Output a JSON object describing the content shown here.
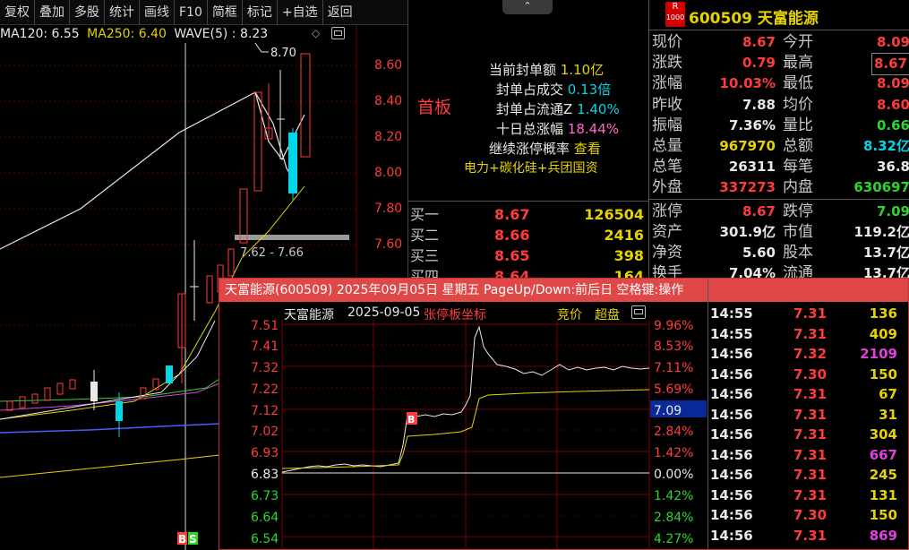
{
  "toolbar": [
    "复权",
    "叠加",
    "多股",
    "统计",
    "画线",
    "F10",
    "简框",
    "标记",
    "+自选",
    "返回"
  ],
  "kline": {
    "ma_legend": {
      "ma120": "MA120: 6.55",
      "ma250": "MA250: 6.40",
      "wave": "WAVE(5) : 8.23"
    },
    "yticks": [
      "8.60",
      "8.40",
      "8.20",
      "8.00",
      "7.80",
      "7.60"
    ],
    "high_label": "8.70",
    "range_label": "7.62 - 7.66",
    "markers": [
      "B",
      "S"
    ]
  },
  "info": {
    "first_board": "首板",
    "rows": [
      {
        "label": "当前封单额",
        "value": "1.10亿"
      },
      {
        "label": "封单占成交",
        "value": "0.13倍"
      },
      {
        "label": "封单占流通Z",
        "value": "1.40%"
      },
      {
        "label": "十日总涨幅",
        "value": "18.44%"
      },
      {
        "label": "继续涨停概率",
        "value": "查看"
      }
    ],
    "concepts": "电力+碳化硅+兵团国资"
  },
  "order_book": [
    {
      "label": "买一",
      "price": "8.67",
      "vol": "126504"
    },
    {
      "label": "买二",
      "price": "8.66",
      "vol": "2416"
    },
    {
      "label": "买三",
      "price": "8.65",
      "vol": "398"
    },
    {
      "label": "买四",
      "price": "8.64",
      "vol": "164"
    }
  ],
  "quote": {
    "badge_r": "R",
    "badge_num": "1000",
    "title": "600509 天富能源",
    "rows": [
      {
        "l1": "现价",
        "v1": "8.67",
        "l2": "今开",
        "v2": "8.09"
      },
      {
        "l1": "涨跌",
        "v1": "0.79",
        "l2": "最高",
        "v2": "8.67"
      },
      {
        "l1": "涨幅",
        "v1": "10.03%",
        "l2": "最低",
        "v2": "8.09"
      },
      {
        "l1": "昨收",
        "v1": "7.88",
        "l2": "均价",
        "v2": "8.60"
      },
      {
        "l1": "振幅",
        "v1": "7.36%",
        "l2": "量比",
        "v2": "0.66"
      },
      {
        "l1": "总量",
        "v1": "967970",
        "l2": "总额",
        "v2": "8.32亿"
      },
      {
        "l1": "总笔",
        "v1": "26311",
        "l2": "每笔",
        "v2": "36.8"
      },
      {
        "l1": "外盘",
        "v1": "337273",
        "l2": "内盘",
        "v2": "630697"
      },
      {
        "l1": "涨停",
        "v1": "8.67",
        "l2": "跌停",
        "v2": "7.09"
      },
      {
        "l1": "资产",
        "v1": "301.9亿",
        "l2": "市值",
        "v2": "119.2亿"
      },
      {
        "l1": "净资",
        "v1": "5.60",
        "l2": "股本",
        "v2": "13.7亿"
      },
      {
        "l1": "换手",
        "v1": "7.04%",
        "l2": "流通",
        "v2": "13.7亿"
      }
    ]
  },
  "popup": {
    "title": "天富能源(600509) 2025年09月05日 星期五 PageUp/Down:前后日 空格键:操作",
    "stock": "天富能源",
    "date": "2025-09-05",
    "limit_label": "张停板坐标",
    "btn_auction": "竞价",
    "btn_super": "超盘",
    "left_ticks": [
      "7.51",
      "7.41",
      "7.32",
      "7.22",
      "7.12",
      "7.02",
      "6.93",
      "6.83",
      "6.73",
      "6.64",
      "6.54"
    ],
    "right_ticks": [
      "9.96%",
      "8.53%",
      "7.11%",
      "5.69%",
      "4.27%",
      "2.84%",
      "1.42%",
      "0.00%",
      "1.42%",
      "2.84%",
      "4.27%"
    ],
    "current_box": "7.09",
    "buy_marker": "B"
  },
  "ticks": [
    {
      "time": "14:55",
      "price": "7.31",
      "vol": "136"
    },
    {
      "time": "14:55",
      "price": "7.31",
      "vol": "409"
    },
    {
      "time": "14:56",
      "price": "7.32",
      "vol": "2109"
    },
    {
      "time": "14:56",
      "price": "7.30",
      "vol": "150"
    },
    {
      "time": "14:56",
      "price": "7.31",
      "vol": "67"
    },
    {
      "time": "14:56",
      "price": "7.31",
      "vol": "31"
    },
    {
      "time": "14:56",
      "price": "7.31",
      "vol": "304"
    },
    {
      "time": "14:56",
      "price": "7.31",
      "vol": "667"
    },
    {
      "time": "14:56",
      "price": "7.31",
      "vol": "245"
    },
    {
      "time": "14:56",
      "price": "7.31",
      "vol": "131"
    },
    {
      "time": "14:56",
      "price": "7.30",
      "vol": "150"
    },
    {
      "time": "14:56",
      "price": "7.31",
      "vol": "869"
    }
  ],
  "colors": {
    "up": "#ff3b3b",
    "down": "#2bd62b",
    "flat": "#e8e8e8",
    "vol_yellow": "#e6d200",
    "vol_magenta": "#e040e0",
    "popup_title_bg": "#e04848"
  }
}
